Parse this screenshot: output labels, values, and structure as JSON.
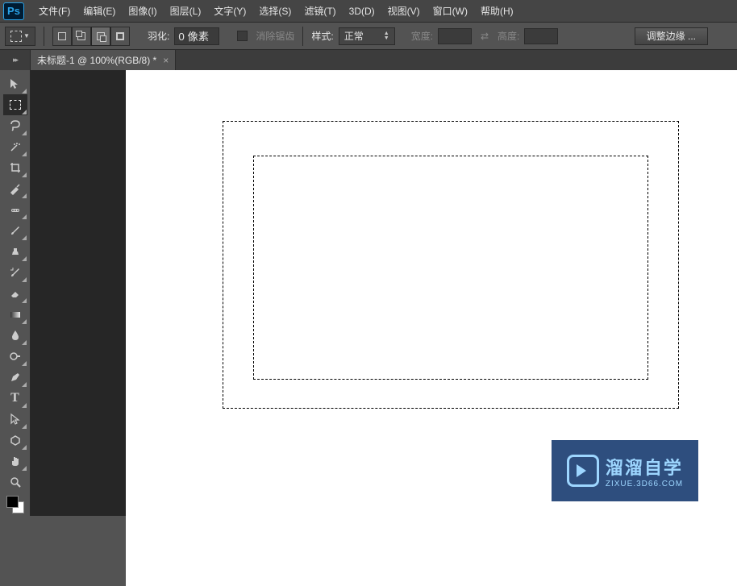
{
  "logo": "Ps",
  "menu": {
    "file": "文件(F)",
    "edit": "编辑(E)",
    "image": "图像(I)",
    "layer": "图层(L)",
    "type": "文字(Y)",
    "select": "选择(S)",
    "filter": "滤镜(T)",
    "threeD": "3D(D)",
    "view": "视图(V)",
    "window": "窗口(W)",
    "help": "帮助(H)"
  },
  "options": {
    "feather_label": "羽化:",
    "feather_value": "0 像素",
    "antialias": "消除锯齿",
    "style_label": "样式:",
    "style_value": "正常",
    "width_label": "宽度:",
    "height_label": "高度:",
    "refine": "调整边缘 ..."
  },
  "tab": {
    "title": "未标题-1 @ 100%(RGB/8) *",
    "close": "×"
  },
  "watermark": {
    "big": "溜溜自学",
    "small": "ZIXUE.3D66.COM"
  }
}
